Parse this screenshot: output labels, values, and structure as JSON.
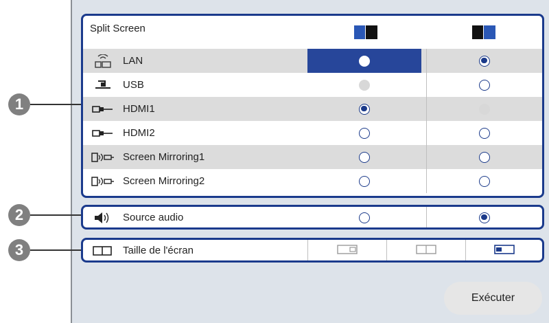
{
  "callouts": [
    "1",
    "2",
    "3"
  ],
  "split_screen": {
    "title": "Split Screen",
    "sources": [
      {
        "label": "LAN",
        "icon": "lan-icon",
        "left": "disabled-selected",
        "right": "selected"
      },
      {
        "label": "USB",
        "icon": "usb-icon",
        "left": "disabled",
        "right": "empty"
      },
      {
        "label": "HDMI1",
        "icon": "hdmi-icon",
        "left": "selected",
        "right": "disabled"
      },
      {
        "label": "HDMI2",
        "icon": "hdmi-icon",
        "left": "empty",
        "right": "empty"
      },
      {
        "label": "Screen Mirroring1",
        "icon": "screen-mirroring-icon",
        "left": "empty",
        "right": "empty"
      },
      {
        "label": "Screen Mirroring2",
        "icon": "screen-mirroring-icon",
        "left": "empty",
        "right": "empty"
      }
    ]
  },
  "source_audio": {
    "label": "Source audio",
    "icon": "speaker-icon",
    "left": "empty",
    "right": "selected"
  },
  "screen_size": {
    "label": "Taille de l'écran",
    "icon": "screen-size-icon",
    "selected_index": 2
  },
  "execute_button": "Exécuter",
  "colors": {
    "accent": "#1a3a8c",
    "panel": "#dde3ea"
  }
}
